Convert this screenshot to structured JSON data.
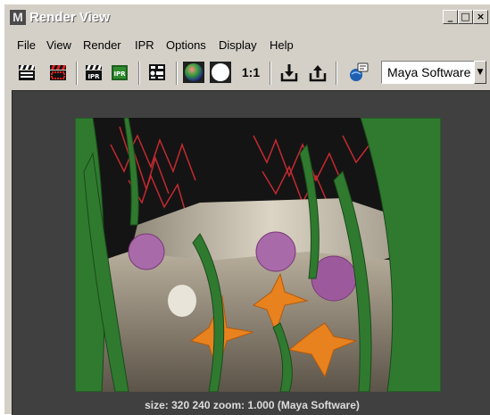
{
  "window": {
    "title": "Render View",
    "minimize_glyph": "_",
    "maximize_glyph": "□",
    "close_glyph": "×"
  },
  "menu": [
    "File",
    "View",
    "Render",
    "IPR",
    "Options",
    "Display",
    "Help"
  ],
  "toolbar": {
    "items": [
      {
        "name": "render-current-frame-button",
        "icon": "clapper-icon"
      },
      {
        "name": "render-region-button",
        "icon": "clapper-region-icon"
      },
      {
        "name": "ipr-render-button",
        "icon": "ipr-clapper-icon",
        "label": "IPR"
      },
      {
        "name": "refresh-ipr-button",
        "icon": "ipr-refresh-icon",
        "label": "IPR"
      },
      {
        "name": "render-settings-button",
        "icon": "settings-icon"
      },
      {
        "name": "rgb-channels-button",
        "icon": "rgb-sphere-icon"
      },
      {
        "name": "alpha-channel-button",
        "icon": "alpha-sphere-icon"
      },
      {
        "name": "real-size-button",
        "icon": "real-size-icon",
        "label": "1:1"
      },
      {
        "name": "keep-image-button",
        "icon": "keep-image-icon"
      },
      {
        "name": "remove-image-button",
        "icon": "remove-image-icon"
      },
      {
        "name": "render-info-button",
        "icon": "info-globe-icon"
      }
    ],
    "renderer_value": "Maya Software",
    "renderer_arrow": "▼"
  },
  "status_text": "size:  320  240 zoom: 1.000  (Maya Software)",
  "colors": {
    "window_bg": "#d4d0c8",
    "viewport_bg": "#404040",
    "status_text": "#dcdcdc"
  }
}
